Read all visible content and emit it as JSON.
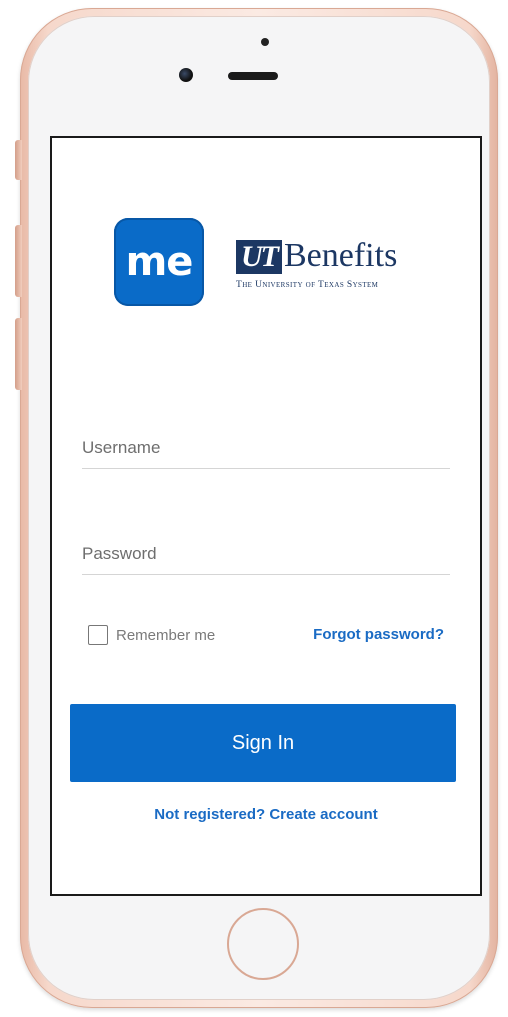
{
  "brand": {
    "me_logo_text": "me",
    "ut_mark": "UT",
    "ut_title": "Benefits",
    "ut_subtitle": "The University of Texas System",
    "accent_color": "#0a6bc8",
    "navy_color": "#1c3763"
  },
  "login": {
    "username_placeholder": "Username",
    "password_placeholder": "Password",
    "remember_label": "Remember me",
    "remember_checked": false,
    "forgot_label": "Forgot password?",
    "signin_label": "Sign In",
    "register_label": "Not registered? Create account"
  }
}
